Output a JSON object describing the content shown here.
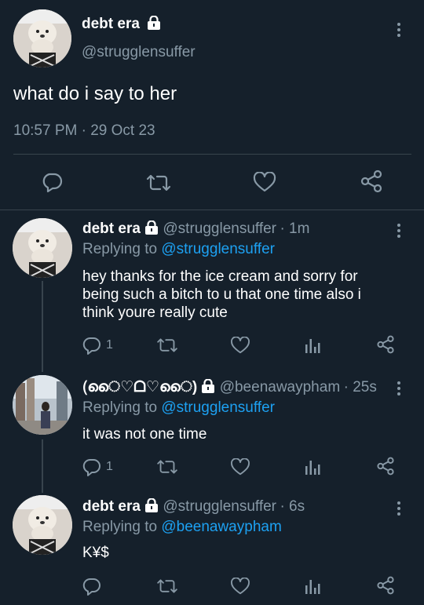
{
  "main_tweet": {
    "display_name": "debt era",
    "handle": "@strugglensuffer",
    "text": "what do i say to her",
    "timestamp": "10:57 PM · 29 Oct 23"
  },
  "replies": [
    {
      "display_name": "debt era",
      "handle": "@strugglensuffer",
      "time": "· 1m",
      "replying_label": "Replying to",
      "replying_to": "@strugglensuffer",
      "text_lines": [
        "hey thanks for the ice cream and sorry for",
        "being such a bitch to u that one time also i",
        "think youre really cute"
      ],
      "reply_count": "1"
    },
    {
      "display_name": "(ൈ♡ᗝ♡ൈ)",
      "handle": "@beenawaypham",
      "time": "· 25s",
      "replying_label": "Replying to",
      "replying_to": "@strugglensuffer",
      "text": "it was not one time",
      "reply_count": "1"
    },
    {
      "display_name": "debt era",
      "handle": "@strugglensuffer",
      "time": "· 6s",
      "replying_label": "Replying to",
      "replying_to": "@beenawaypham",
      "text": "K¥$",
      "reply_count": ""
    }
  ],
  "colors": {
    "background": "#15202b",
    "link": "#1da1f2",
    "muted": "#8899a6",
    "divider": "#38444d"
  }
}
